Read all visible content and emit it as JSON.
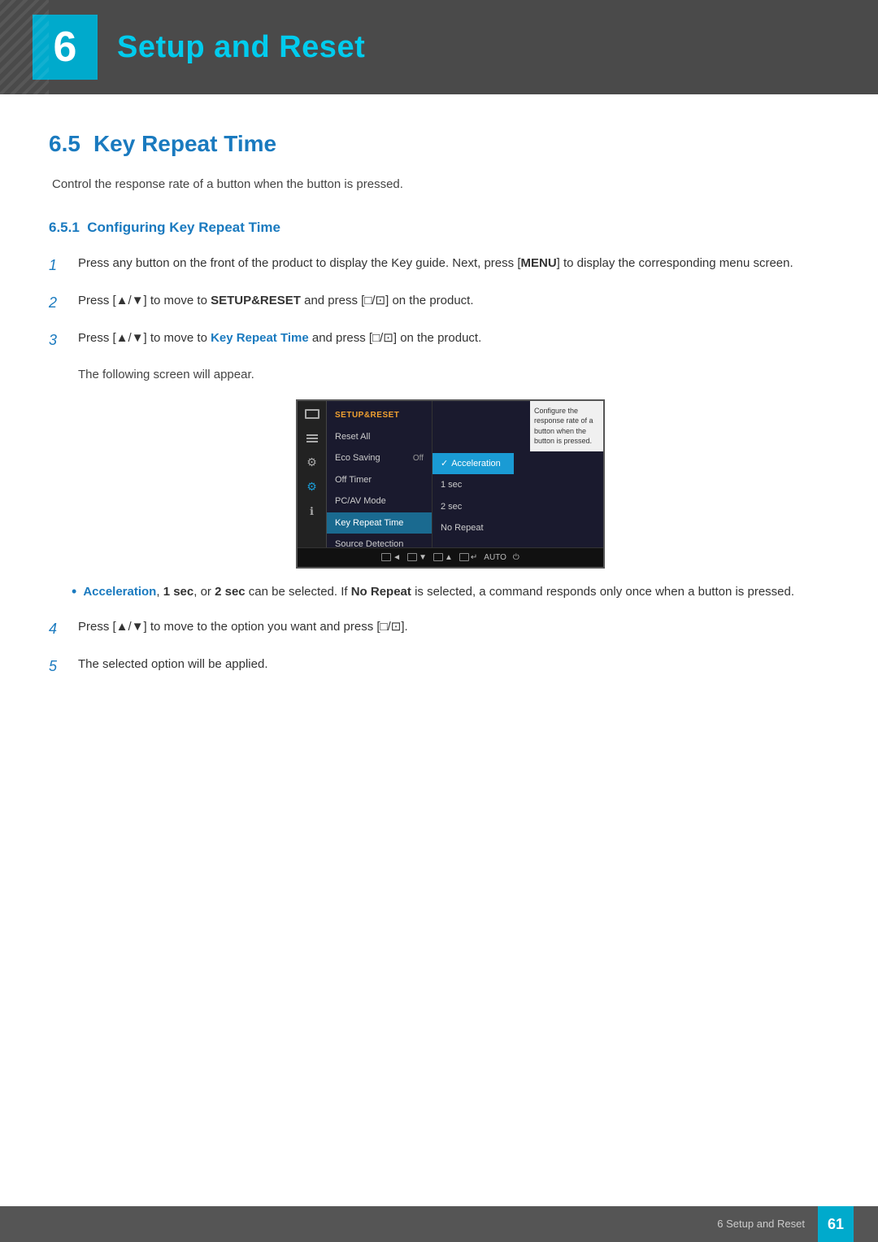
{
  "chapter": {
    "number": "6",
    "title": "Setup and Reset",
    "accent_color": "#00ccee",
    "header_bg": "#4a4a4a",
    "number_bg": "#1a9bd4"
  },
  "section": {
    "number": "6.5",
    "title": "Key Repeat Time",
    "description": "Control the response rate of a button when the button is pressed."
  },
  "subsection": {
    "number": "6.5.1",
    "title": "Configuring Key Repeat Time"
  },
  "steps": [
    {
      "number": "1",
      "text_parts": [
        {
          "text": "Press any button on the front of the product to display the Key guide. Next, press [",
          "bold": false
        },
        {
          "text": "MENU",
          "bold": true
        },
        {
          "text": "] to display the corresponding menu screen.",
          "bold": false
        }
      ]
    },
    {
      "number": "2",
      "text_parts": [
        {
          "text": "Press [▲/▼] to move to ",
          "bold": false
        },
        {
          "text": "SETUP&RESET",
          "bold": true
        },
        {
          "text": " and press [□/⊡] on the product.",
          "bold": false
        }
      ]
    },
    {
      "number": "3",
      "text_parts": [
        {
          "text": "Press [▲/▼] to move to ",
          "bold": false
        },
        {
          "text": "Key Repeat Time",
          "bold": true,
          "color": "blue"
        },
        {
          "text": " and press [□/⊡] on the product.",
          "bold": false
        }
      ],
      "sub_text": "The following screen will appear."
    }
  ],
  "screen": {
    "menu_title": "SETUP&RESET",
    "menu_items": [
      {
        "label": "Reset All",
        "value": "",
        "active": false
      },
      {
        "label": "Eco Saving",
        "value": "Off",
        "active": false
      },
      {
        "label": "Off Timer",
        "value": "",
        "active": false
      },
      {
        "label": "PC/AV Mode",
        "value": "",
        "active": false
      },
      {
        "label": "Key Repeat Time",
        "value": "",
        "active": true
      },
      {
        "label": "Source Detection",
        "value": "",
        "active": false
      }
    ],
    "submenu_items": [
      {
        "label": "Acceleration",
        "active": true,
        "check": true
      },
      {
        "label": "1 sec",
        "active": false
      },
      {
        "label": "2 sec",
        "active": false
      },
      {
        "label": "No Repeat",
        "active": false
      }
    ],
    "tooltip": "Configure the response rate of a button when the button is pressed.",
    "bottom_buttons": [
      "◄",
      "▼",
      "▲",
      "↵",
      "AUTO",
      "⏻"
    ]
  },
  "bullet": {
    "text_parts": [
      {
        "text": "Acceleration",
        "bold": true,
        "color": "blue"
      },
      {
        "text": ", ",
        "bold": false
      },
      {
        "text": "1 sec",
        "bold": true
      },
      {
        "text": ", or ",
        "bold": false
      },
      {
        "text": "2 sec",
        "bold": true
      },
      {
        "text": " can be selected. If ",
        "bold": false
      },
      {
        "text": "No Repeat",
        "bold": true
      },
      {
        "text": " is selected, a command responds only once when a button is pressed.",
        "bold": false
      }
    ]
  },
  "steps_continued": [
    {
      "number": "4",
      "text": "Press [▲/▼] to move to the option you want and press [□/⊡]."
    },
    {
      "number": "5",
      "text": "The selected option will be applied."
    }
  ],
  "footer": {
    "text": "6 Setup and Reset",
    "page": "61"
  }
}
